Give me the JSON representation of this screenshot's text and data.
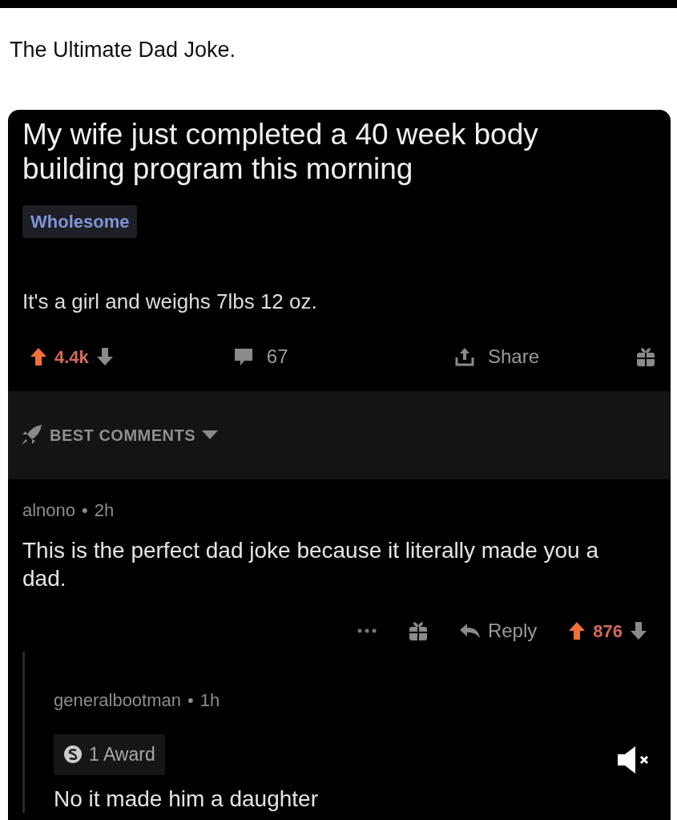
{
  "caption": "The Ultimate Dad Joke.",
  "post": {
    "title": "My wife just completed a 40 week body building program this morning",
    "flair": "Wholesome",
    "body": "It's a girl and weighs 7lbs 12 oz.",
    "score": "4.4k",
    "comments_count": "67",
    "share_label": "Share"
  },
  "sort": {
    "label": "BEST COMMENTS"
  },
  "comments": [
    {
      "author": "alnono",
      "separator": "•",
      "time": "2h",
      "body": "This is the perfect dad joke because it literally made you a dad.",
      "reply_label": "Reply",
      "score": "876",
      "children": [
        {
          "author": "generalbootman",
          "separator": "•",
          "time": "1h",
          "award": "1 Award",
          "body": "No it made him a daughter"
        }
      ]
    }
  ]
}
